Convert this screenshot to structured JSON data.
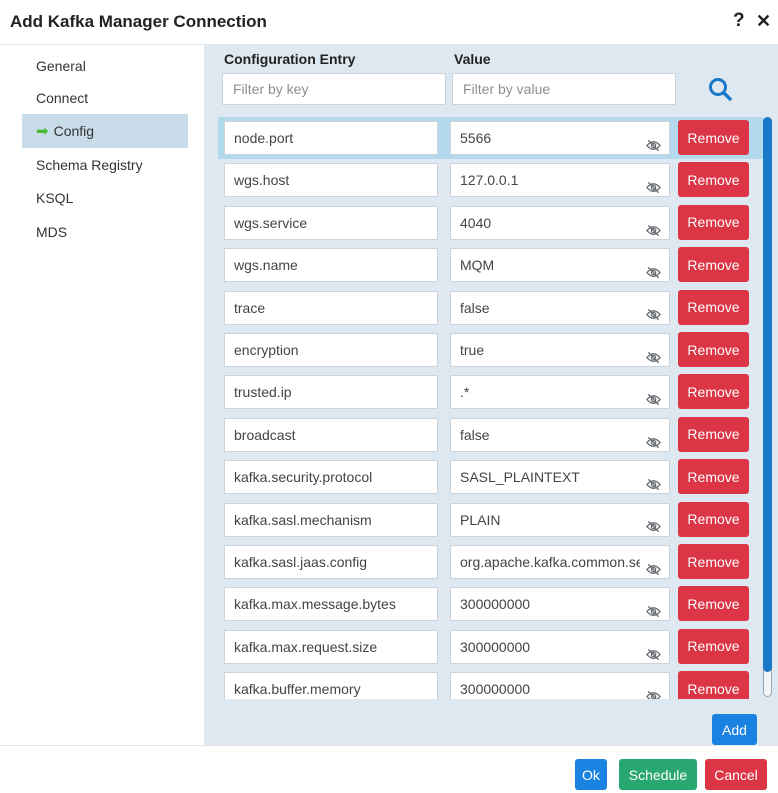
{
  "dialog": {
    "title": "Add Kafka Manager Connection",
    "help_icon": "question-icon",
    "close_icon": "close-icon"
  },
  "sidebar": {
    "items": [
      {
        "label": "General"
      },
      {
        "label": "Connect"
      },
      {
        "label": "Config",
        "active": true,
        "icon": "arrow-right-icon"
      },
      {
        "label": "Schema Registry"
      },
      {
        "label": "KSQL"
      },
      {
        "label": "MDS"
      }
    ]
  },
  "config": {
    "key_header": "Configuration Entry",
    "value_header": "Value",
    "key_filter_placeholder": "Filter by key",
    "value_filter_placeholder": "Filter by value",
    "search_icon": "search-icon",
    "remove_label": "Remove",
    "hidden_icon": "eye-slash-icon",
    "entries": [
      {
        "key": "node.port",
        "value": "5566"
      },
      {
        "key": "wgs.host",
        "value": "127.0.0.1"
      },
      {
        "key": "wgs.service",
        "value": "4040"
      },
      {
        "key": "wgs.name",
        "value": "MQM"
      },
      {
        "key": "trace",
        "value": "false"
      },
      {
        "key": "encryption",
        "value": "true"
      },
      {
        "key": "trusted.ip",
        "value": ".*"
      },
      {
        "key": "broadcast",
        "value": "false"
      },
      {
        "key": "kafka.security.protocol",
        "value": "SASL_PLAINTEXT"
      },
      {
        "key": "kafka.sasl.mechanism",
        "value": "PLAIN"
      },
      {
        "key": "kafka.sasl.jaas.config",
        "value": "org.apache.kafka.common.se"
      },
      {
        "key": "kafka.max.message.bytes",
        "value": "300000000"
      },
      {
        "key": "kafka.max.request.size",
        "value": "300000000"
      },
      {
        "key": "kafka.buffer.memory",
        "value": "300000000"
      }
    ],
    "add_label": "Add"
  },
  "footer": {
    "ok_label": "Ok",
    "schedule_label": "Schedule",
    "cancel_label": "Cancel"
  },
  "colors": {
    "remove": "#dc3545",
    "primary": "#1a83e2",
    "schedule": "#28a870",
    "panel_bg": "#dde8f1",
    "active_nav": "#c8dbe9",
    "nav_arrow": "#49b834"
  }
}
